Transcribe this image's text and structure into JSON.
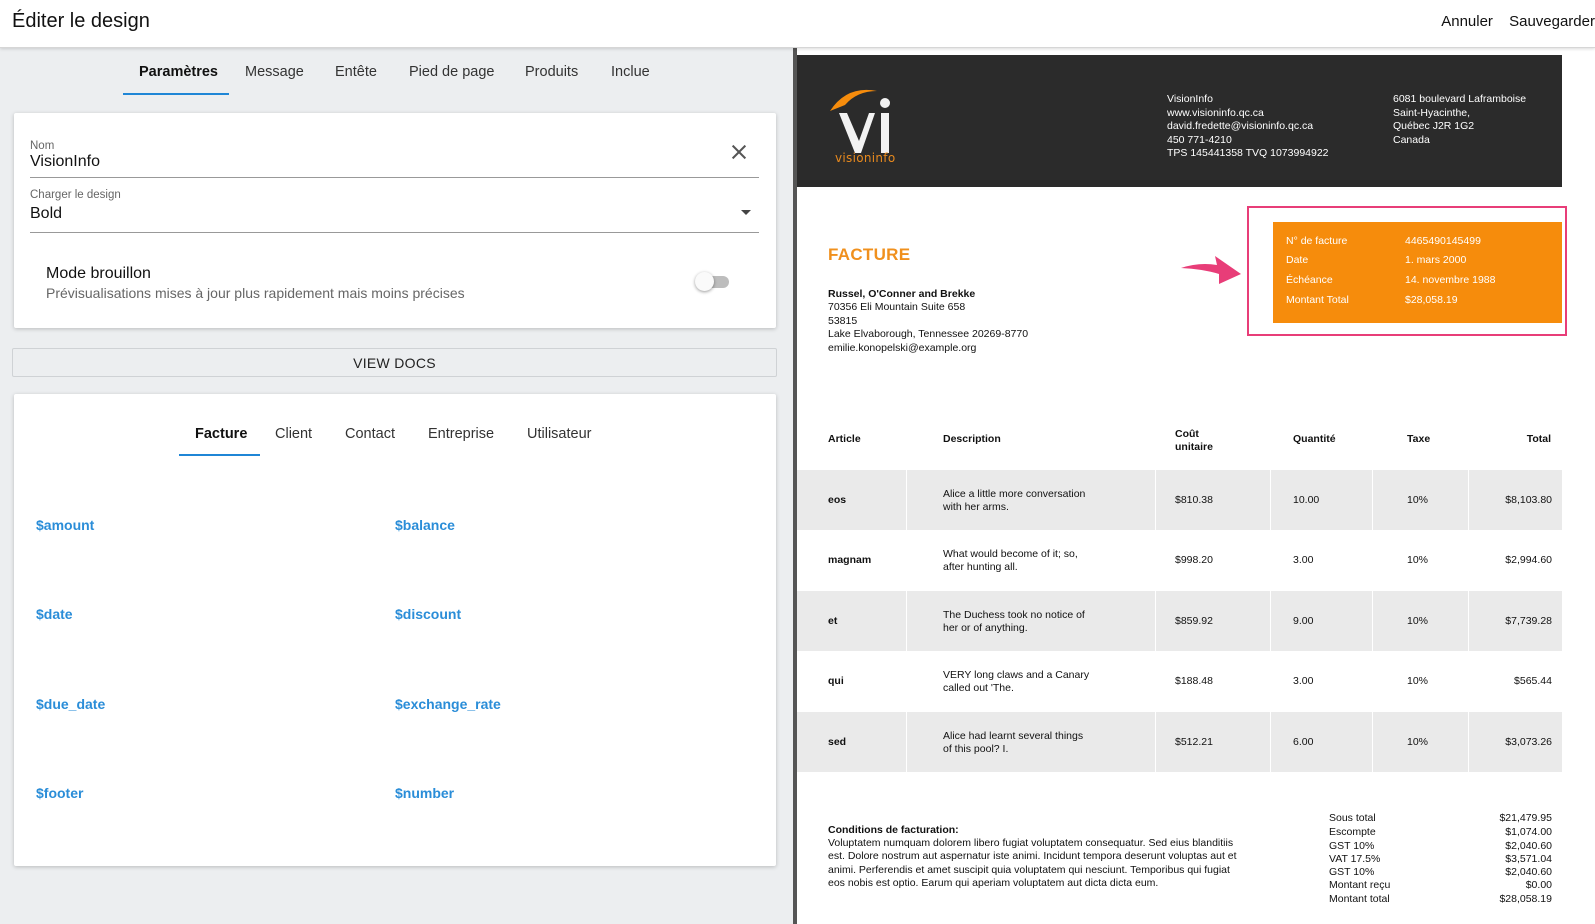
{
  "topbar": {
    "title": "Éditer le design",
    "cancel": "Annuler",
    "save": "Sauvegarder"
  },
  "tabs_top": [
    {
      "label": "Paramètres",
      "active": true
    },
    {
      "label": "Message"
    },
    {
      "label": "Entête"
    },
    {
      "label": "Pied de page"
    },
    {
      "label": "Produits"
    },
    {
      "label": "Inclue"
    }
  ],
  "settings": {
    "name_label": "Nom",
    "name_value": "VisionInfo",
    "design_label": "Charger le design",
    "design_value": "Bold",
    "draft_title": "Mode brouillon",
    "draft_desc": "Prévisualisations mises à jour plus rapidement mais moins précises",
    "draft_enabled": false
  },
  "view_docs": "VIEW DOCS",
  "tabs_inner": [
    {
      "label": "Facture",
      "active": true
    },
    {
      "label": "Client"
    },
    {
      "label": "Contact"
    },
    {
      "label": "Entreprise"
    },
    {
      "label": "Utilisateur"
    }
  ],
  "variables": [
    "$amount",
    "$balance",
    "$date",
    "$discount",
    "$due_date",
    "$exchange_rate",
    "$footer",
    "$number"
  ],
  "invoice": {
    "logo_text": "visioninfo",
    "company": [
      "VisionInfo",
      "www.visioninfo.qc.ca",
      "david.fredette@visioninfo.qc.ca",
      "450 771-4210",
      "TPS 145441358 TVQ 1073994922"
    ],
    "address": [
      "6081 boulevard Laframboise",
      "Saint-Hyacinthe,",
      "Québec J2R 1G2",
      "Canada"
    ],
    "title": "FACTURE",
    "client_name": "Russel, O'Conner and Brekke",
    "client_lines": [
      "70356 Eli Mountain Suite 658",
      "53815",
      "Lake Elvaborough, Tennessee 20269-8770",
      "emilie.konopelski@example.org"
    ],
    "details": [
      {
        "label": "N° de facture",
        "value": "4465490145499"
      },
      {
        "label": "Date",
        "value": "1. mars 2000"
      },
      {
        "label": "Échéance",
        "value": "14. novembre 1988"
      },
      {
        "label": "Montant Total",
        "value": "$28,058.19"
      }
    ],
    "accent_color": "#f68c0c",
    "highlight_color": "#e83d78",
    "columns": [
      "Article",
      "Description",
      "Coût unitaire",
      "Quantité",
      "Taxe",
      "Total"
    ],
    "items": [
      {
        "article": "eos",
        "desc1": "Alice a little more conversation",
        "desc2": "with her arms.",
        "cost": "$810.38",
        "qty": "10.00",
        "tax": "10%",
        "total": "$8,103.80"
      },
      {
        "article": "magnam",
        "desc1": "What would become of it; so,",
        "desc2": "after hunting all.",
        "cost": "$998.20",
        "qty": "3.00",
        "tax": "10%",
        "total": "$2,994.60"
      },
      {
        "article": "et",
        "desc1": "The Duchess took no notice of",
        "desc2": "her or of anything.",
        "cost": "$859.92",
        "qty": "9.00",
        "tax": "10%",
        "total": "$7,739.28"
      },
      {
        "article": "qui",
        "desc1": "VERY long claws and a Canary",
        "desc2": "called out 'The.",
        "cost": "$188.48",
        "qty": "3.00",
        "tax": "10%",
        "total": "$565.44"
      },
      {
        "article": "sed",
        "desc1": "Alice had learnt several things",
        "desc2": "of this pool? I.",
        "cost": "$512.21",
        "qty": "6.00",
        "tax": "10%",
        "total": "$3,073.26"
      }
    ],
    "terms_title": "Conditions de facturation:",
    "terms_lines": [
      "Voluptatem numquam dolorem libero fugiat voluptatem consequatur. Sed eius blanditiis",
      "est. Dolore nostrum aut aspernatur iste animi. Incidunt tempora deserunt voluptas aut et",
      "animi. Perferendis et amet suscipit quia voluptatem qui nesciunt. Temporibus qui fugiat",
      "eos nobis est optio. Earum qui aperiam voluptatem aut dicta dicta eum."
    ],
    "totals": [
      {
        "label": "Sous total",
        "value": "$21,479.95"
      },
      {
        "label": "Escompte",
        "value": "$1,074.00"
      },
      {
        "label": "GST 10%",
        "value": "$2,040.60"
      },
      {
        "label": "VAT 17.5%",
        "value": "$3,571.04"
      },
      {
        "label": "GST 10%",
        "value": "$2,040.60"
      },
      {
        "label": "Montant reçu",
        "value": "$0.00"
      },
      {
        "label": "Montant total",
        "value": "$28,058.19"
      }
    ]
  }
}
